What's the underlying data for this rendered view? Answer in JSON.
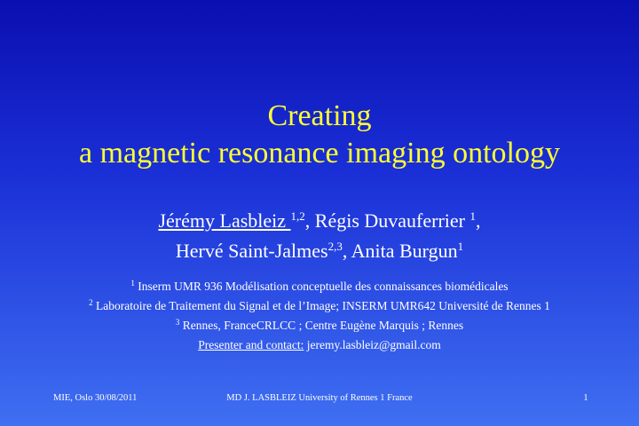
{
  "slide": {
    "title_line1": "Creating",
    "title_line2": "a magnetic resonance imaging ontology",
    "authors": {
      "a1_name": "Jérémy Lasbleiz ",
      "a1_sup": "1,2",
      "a1_after": ", Régis Duvauferrier ",
      "a2_sup": "1",
      "a2_after": ",",
      "a3_name": "Hervé Saint-Jalmes",
      "a3_sup": "2,3",
      "a3_after": ", Anita Burgun",
      "a4_sup": "1"
    },
    "affiliations": [
      {
        "sup": "1",
        "text": " Inserm UMR 936 Modélisation conceptuelle des connaissances biomédicales"
      },
      {
        "sup": "2",
        "text": " Laboratoire de Traitement du Signal et de l’Image; INSERM UMR642 Université de Rennes 1"
      },
      {
        "sup": "3",
        "text": " Rennes, FranceCRLCC ; Centre Eugène Marquis ; Rennes"
      }
    ],
    "contact_label": "Presenter and contact:",
    "contact_email": " jeremy.lasbleiz@gmail.com",
    "footer_left": "MIE, Oslo 30/08/2011",
    "footer_center": "MD J. LASBLEIZ University of Rennes 1 France",
    "footer_page": "1"
  }
}
